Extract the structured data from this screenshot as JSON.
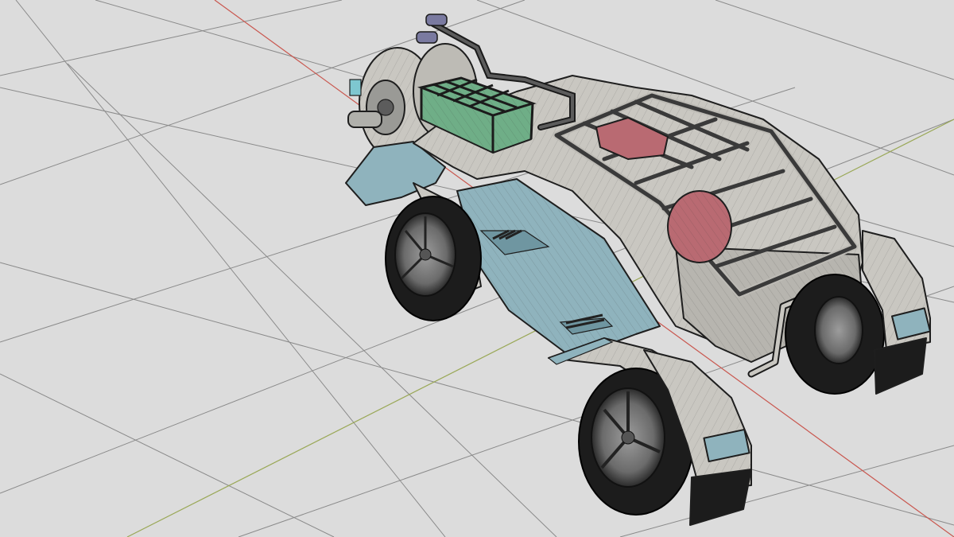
{
  "viewport": {
    "label": "",
    "mode": "3d-wireframe-on-shaded",
    "colors": {
      "background": "#dcdcdc",
      "grid_line": "#8a8a8a",
      "axis_x": "#c9574f",
      "axis_y": "#9aa857",
      "body_light": "#c9c7c1",
      "body_shadow": "#a9a8a3",
      "panel_blue": "#8fb3bd",
      "panel_blue_dark": "#6f96a1",
      "cargo_red": "#b96a72",
      "tank_green": "#6fae87",
      "tire": "#1c1c1c"
    }
  },
  "scene": {
    "object": "offroad-buggy-model",
    "shading": "solid-with-wireframe",
    "show_grid": true,
    "show_axes": true
  }
}
